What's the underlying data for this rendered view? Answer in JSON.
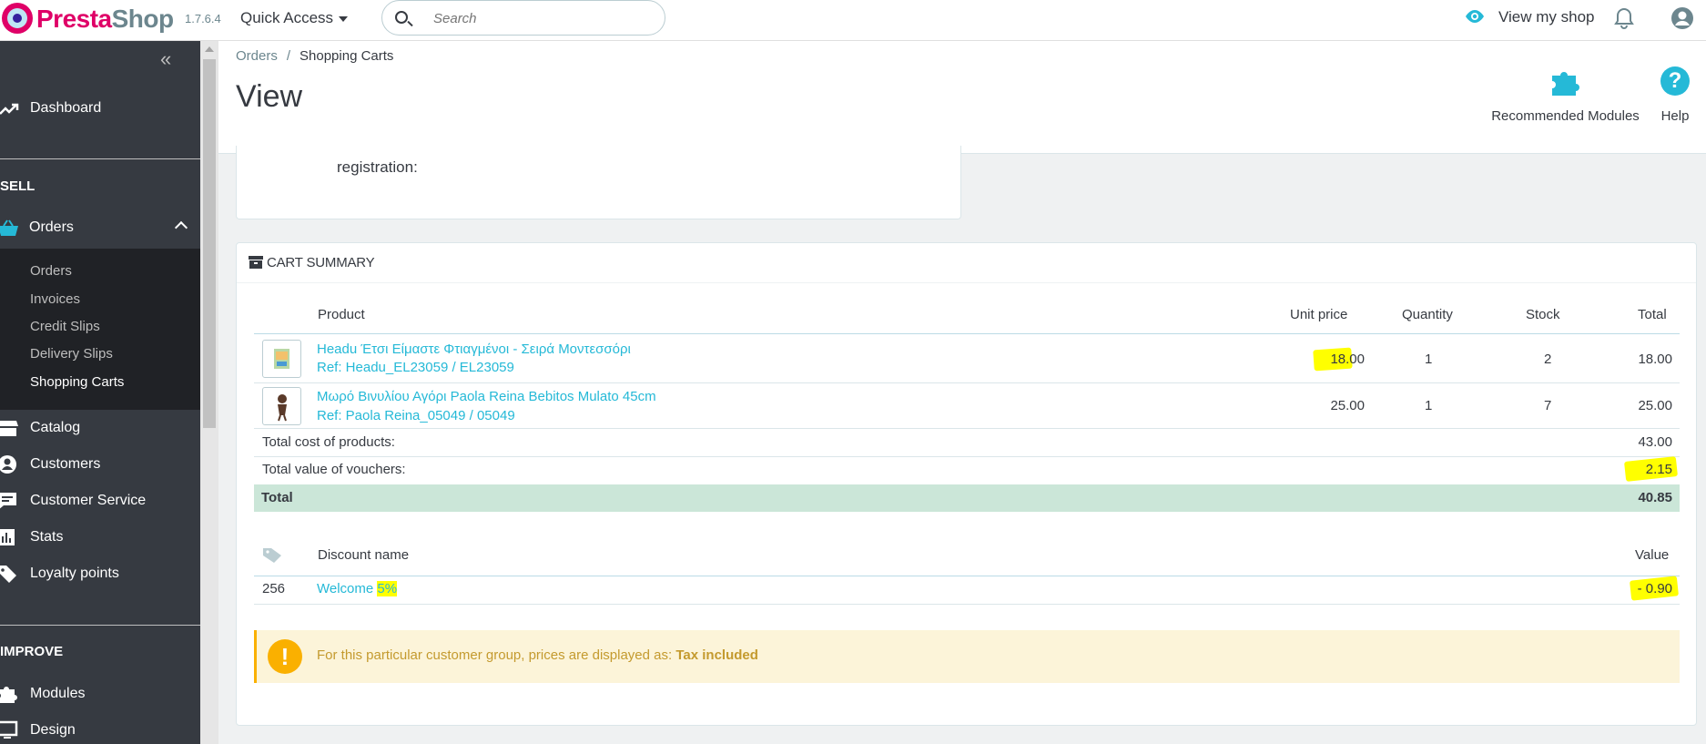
{
  "header": {
    "brand_pre": "Presta",
    "brand_post": "Shop",
    "version": "1.7.6.4",
    "quick_access": "Quick Access",
    "search_placeholder": "Search",
    "view_shop": "View my shop",
    "icons": [
      "search-icon",
      "eye-icon",
      "bell-icon",
      "user-icon"
    ]
  },
  "sidebar": {
    "dashboard": "Dashboard",
    "sell": "SELL",
    "orders": "Orders",
    "orders_sub": [
      "Orders",
      "Invoices",
      "Credit Slips",
      "Delivery Slips",
      "Shopping Carts"
    ],
    "catalog": "Catalog",
    "customers": "Customers",
    "customer_service": "Customer Service",
    "stats": "Stats",
    "loyalty": "Loyalty points",
    "improve": "IMPROVE",
    "modules": "Modules",
    "design": "Design"
  },
  "page": {
    "breadcrumb_parent": "Orders",
    "breadcrumb_sep": "/",
    "breadcrumb_current": "Shopping Carts",
    "title": "View",
    "recommended_modules": "Recommended Modules",
    "help": "Help",
    "help_glyph": "?"
  },
  "top_card": {
    "registration_label": "registration:"
  },
  "cart_summary": {
    "title": "CART SUMMARY",
    "columns": {
      "product": "Product",
      "unit_price": "Unit price",
      "quantity": "Quantity",
      "stock": "Stock",
      "total": "Total"
    },
    "products": [
      {
        "name": "Headu Έτσι Είμαστε Φτιαγμένοι - Σειρά Μοντεσσόρι",
        "ref": "Ref: Headu_EL23059 / EL23059",
        "unit_price": "18.00",
        "quantity": "1",
        "stock": "2",
        "total": "18.00"
      },
      {
        "name": "Μωρό Βινυλίου Αγόρι Paola Reina Bebitos Mulato 45cm",
        "ref": "Ref: Paola Reina_05049 / 05049",
        "unit_price": "25.00",
        "quantity": "1",
        "stock": "7",
        "total": "25.00"
      }
    ],
    "total_products_label": "Total cost of products:",
    "total_products_value": "43.00",
    "total_vouchers_label": "Total value of vouchers:",
    "total_vouchers_value": "2.15",
    "total_label": "Total",
    "total_value": "40.85",
    "discount_columns": {
      "name": "Discount name",
      "value": "Value"
    },
    "discounts": [
      {
        "id": "256",
        "name": "Welcome",
        "name_pct": "5%",
        "value": "- 0.90"
      }
    ],
    "alert_text": "For this particular customer group, prices are displayed as:",
    "alert_strong": "Tax included",
    "alert_glyph": "!"
  },
  "colors": {
    "accent": "#25b9d7",
    "sidebar_bg": "#363a41",
    "total_row_bg": "#cbe6d8",
    "alert_bg": "#fcf4d9",
    "highlight": "#ffff00"
  }
}
